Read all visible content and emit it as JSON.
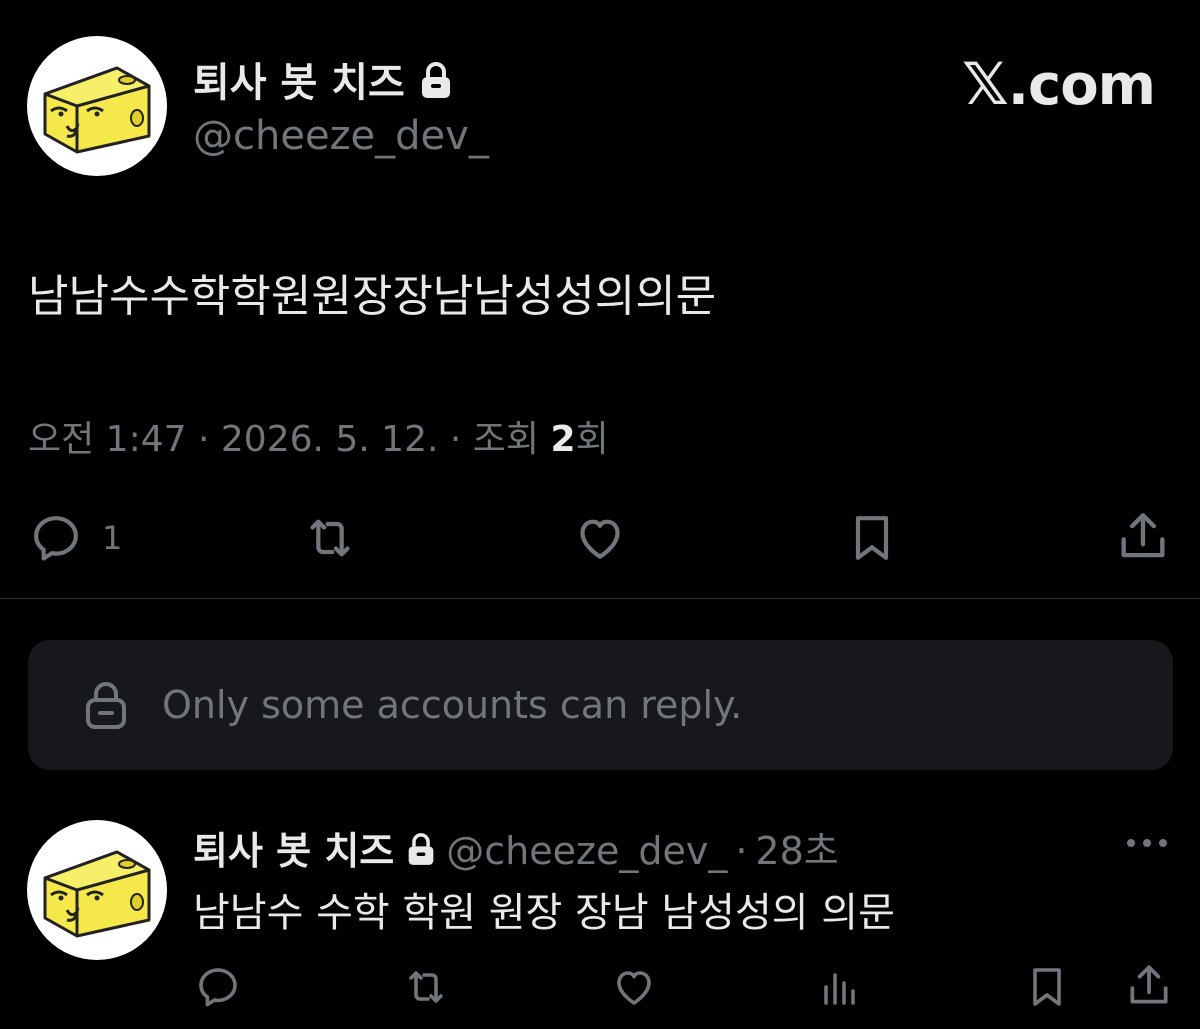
{
  "main_tweet": {
    "author": {
      "display_name": "퇴사 봇 치즈",
      "handle": "@cheeze_dev_",
      "protected_icon": "lock-icon",
      "avatar": "cheese-avatar"
    },
    "site_brand": ".com",
    "site_brand_mark": "𝕏",
    "text": "남남수수학학원원장장남남성성의의문",
    "meta": {
      "time": "오전 1:47",
      "separator": "·",
      "date": "2026. 5. 12.",
      "views_prefix": "조회",
      "views_count": "2",
      "views_suffix": "회"
    },
    "actions": [
      {
        "icon": "reply-icon",
        "count": "1"
      },
      {
        "icon": "retweet-icon",
        "count": ""
      },
      {
        "icon": "like-icon",
        "count": ""
      },
      {
        "icon": "bookmark-icon",
        "count": ""
      },
      {
        "icon": "share-icon",
        "count": ""
      }
    ]
  },
  "reply_restriction": {
    "icon": "lock-icon",
    "text": "Only some accounts can reply."
  },
  "reply_tweet": {
    "display_name": "퇴사 봇 치즈",
    "handle": "@cheeze_dev_",
    "separator": "·",
    "time": "28초",
    "text": "남남수 수학 학원 원장 장남 남성성의 의문",
    "more_icon": "more-icon",
    "actions": [
      "reply-icon",
      "retweet-icon",
      "like-icon",
      "views-icon",
      "bookmark-icon",
      "share-icon"
    ]
  },
  "colors": {
    "background": "#000000",
    "primary_text": "#e7e9ea",
    "secondary_text": "#71767b",
    "reply_box": "#16181c",
    "divider": "#2f3336",
    "avatar_cheese": "#f5e84a"
  }
}
